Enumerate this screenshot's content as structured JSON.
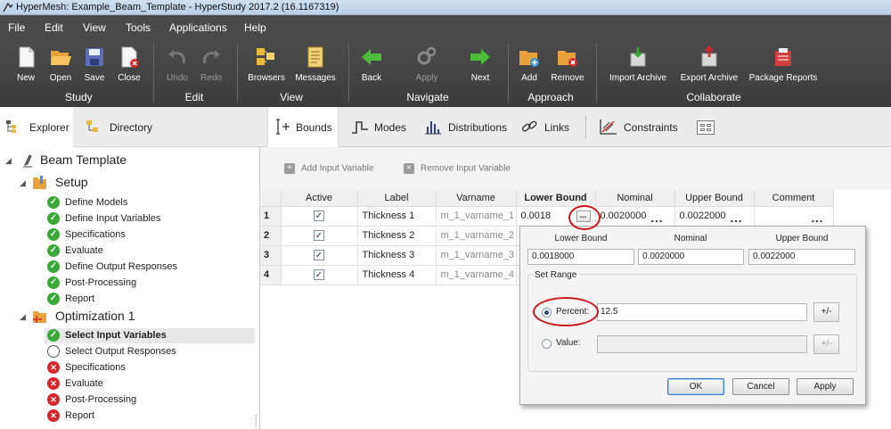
{
  "window": {
    "title": "HyperMesh: Example_Beam_Template - HyperStudy 2017.2 (16.1167319)"
  },
  "menu": [
    "File",
    "Edit",
    "View",
    "Tools",
    "Applications",
    "Help"
  ],
  "ribbon": {
    "buttons": [
      {
        "label": "New",
        "icon": "new-file-icon",
        "enabled": true
      },
      {
        "label": "Open",
        "icon": "open-folder-icon",
        "enabled": true
      },
      {
        "label": "Save",
        "icon": "save-disk-icon",
        "enabled": true
      },
      {
        "label": "Close",
        "icon": "close-file-icon",
        "enabled": true
      },
      {
        "label": "Undo",
        "icon": "undo-icon",
        "enabled": false
      },
      {
        "label": "Redo",
        "icon": "redo-icon",
        "enabled": false
      },
      {
        "label": "Browsers",
        "icon": "browsers-icon",
        "enabled": true
      },
      {
        "label": "Messages",
        "icon": "messages-icon",
        "enabled": true
      },
      {
        "label": "Back",
        "icon": "back-arrow-icon",
        "enabled": true
      },
      {
        "label": "Apply",
        "icon": "gears-icon",
        "enabled": false
      },
      {
        "label": "Next",
        "icon": "next-arrow-icon",
        "enabled": true
      },
      {
        "label": "Add",
        "icon": "add-folder-icon",
        "enabled": true
      },
      {
        "label": "Remove",
        "icon": "remove-folder-icon",
        "enabled": true
      },
      {
        "label": "Import Archive",
        "icon": "import-archive-icon",
        "enabled": true
      },
      {
        "label": "Export Archive",
        "icon": "export-archive-icon",
        "enabled": true
      },
      {
        "label": "Package Reports",
        "icon": "package-reports-icon",
        "enabled": true
      }
    ],
    "groups": [
      "Study",
      "Edit",
      "View",
      "Navigate",
      "Approach",
      "Collaborate"
    ]
  },
  "left_tabs": [
    "Explorer",
    "Directory"
  ],
  "tree": {
    "root": "Beam Template",
    "setup": {
      "label": "Setup",
      "items": [
        {
          "label": "Define Models",
          "status": "ok"
        },
        {
          "label": "Define Input Variables",
          "status": "ok"
        },
        {
          "label": "Specifications",
          "status": "ok"
        },
        {
          "label": "Evaluate",
          "status": "ok"
        },
        {
          "label": "Define Output Responses",
          "status": "ok"
        },
        {
          "label": "Post-Processing",
          "status": "ok"
        },
        {
          "label": "Report",
          "status": "ok"
        }
      ]
    },
    "optimization": {
      "label": "Optimization 1",
      "items": [
        {
          "label": "Select Input Variables",
          "status": "ok",
          "selected": true
        },
        {
          "label": "Select Output Responses",
          "status": "none"
        },
        {
          "label": "Specifications",
          "status": "err"
        },
        {
          "label": "Evaluate",
          "status": "err"
        },
        {
          "label": "Post-Processing",
          "status": "err"
        },
        {
          "label": "Report",
          "status": "err"
        }
      ]
    }
  },
  "right_tabs": [
    "Bounds",
    "Modes",
    "Distributions",
    "Links",
    "Constraints"
  ],
  "toolbar": {
    "add_label": "Add Input Variable",
    "remove_label": "Remove Input Variable"
  },
  "grid": {
    "headers": [
      "Active",
      "Label",
      "Varname",
      "Lower Bound",
      "Nominal",
      "Upper Bound",
      "Comment"
    ],
    "rows": [
      {
        "num": "1",
        "active": true,
        "label": "Thickness 1",
        "varname": "m_1_varname_1",
        "lower": "0.0018",
        "nominal": "0.0020000",
        "upper": "0.0022000"
      },
      {
        "num": "2",
        "active": true,
        "label": "Thickness 2",
        "varname": "m_1_varname_2"
      },
      {
        "num": "3",
        "active": true,
        "label": "Thickness 3",
        "varname": "m_1_varname_3"
      },
      {
        "num": "4",
        "active": true,
        "label": "Thickness 4",
        "varname": "m_1_varname_4"
      }
    ],
    "ellipsis": "...",
    "edit_button": "..."
  },
  "popup": {
    "headers": [
      "Lower Bound",
      "Nominal",
      "Upper Bound"
    ],
    "values": [
      "0.0018000",
      "0.0020000",
      "0.0022000"
    ],
    "group_title": "Set Range",
    "percent_label": "Percent:",
    "percent_value": "12.5",
    "value_label": "Value:",
    "value_value": "",
    "pm_label": "+/-",
    "buttons": {
      "ok": "OK",
      "cancel": "Cancel",
      "apply": "Apply"
    }
  },
  "colors": {
    "ok": "#3aa935",
    "error": "#d6262b",
    "annotation": "#d0161b",
    "ribbon": "#4a4a4a"
  }
}
